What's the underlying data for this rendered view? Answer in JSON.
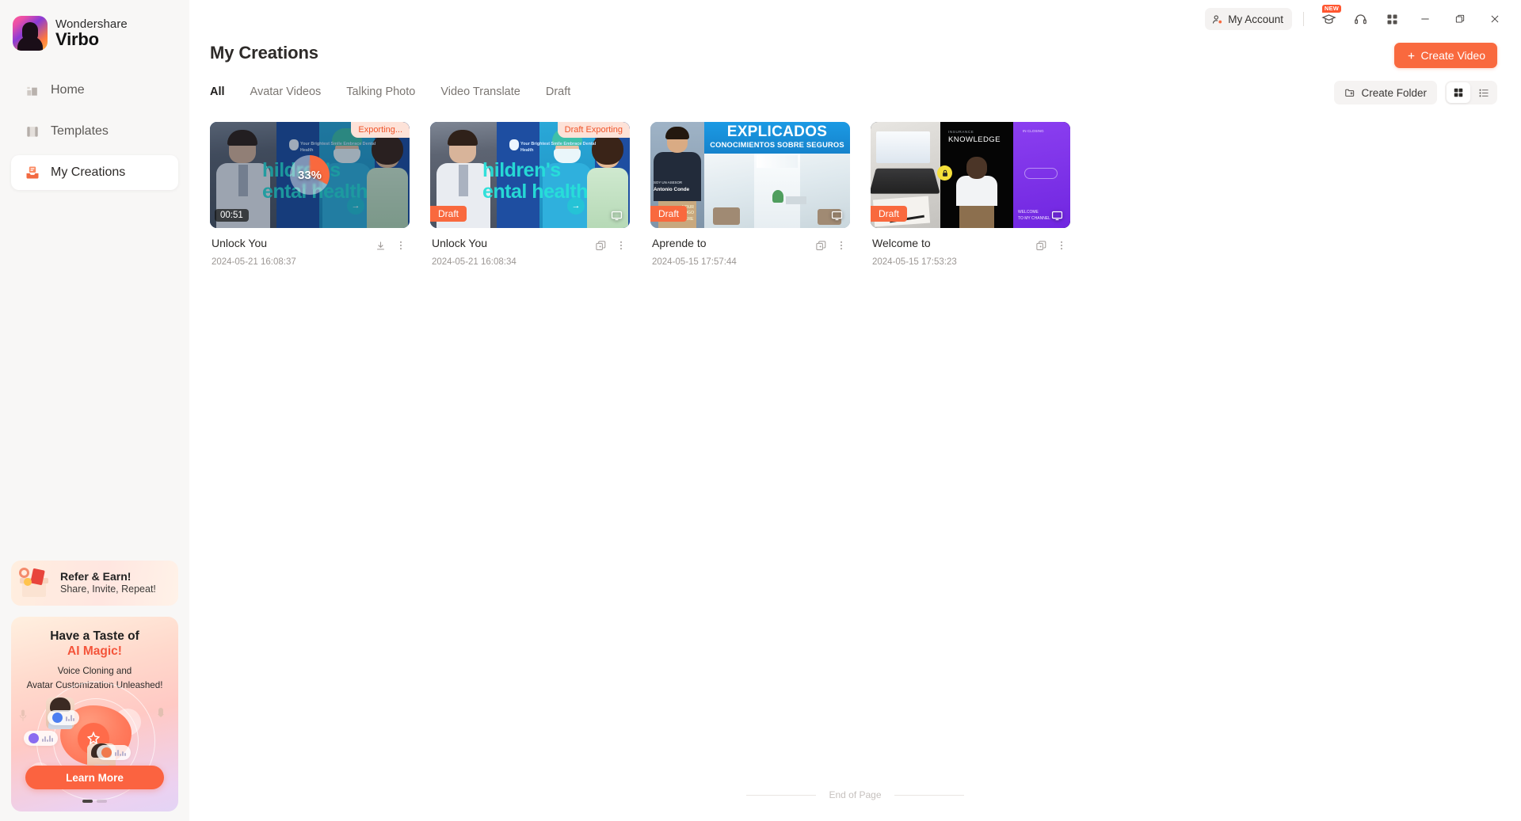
{
  "brand": {
    "top": "Wondershare",
    "bottom": "Virbo",
    "logo_icon": "virbo-avatar-logo"
  },
  "sidebar": {
    "items": [
      {
        "label": "Home",
        "icon": "home-icon",
        "active": false
      },
      {
        "label": "Templates",
        "icon": "templates-icon",
        "active": false
      },
      {
        "label": "My Creations",
        "icon": "my-creations-icon",
        "active": true
      }
    ],
    "refer": {
      "title": "Refer & Earn!",
      "subtitle": "Share, Invite, Repeat!",
      "icon": "gift-box-icon"
    },
    "magic": {
      "line1": "Have a Taste of",
      "line2": "AI Magic!",
      "line3": "Voice Cloning and",
      "line4": "Avatar Customization Unleashed!",
      "button": "Learn More",
      "accent": "#f4543a"
    }
  },
  "titlebar": {
    "account": "My Account",
    "icons": [
      "graduation-cap-icon",
      "headset-support-icon",
      "apps-grid-icon"
    ],
    "new_badge": "NEW",
    "window": [
      "minimize-icon",
      "maximize-icon",
      "close-icon"
    ]
  },
  "header": {
    "title": "My Creations",
    "create_video": "Create Video",
    "create_folder": "Create Folder"
  },
  "tabs": [
    {
      "label": "All",
      "active": true
    },
    {
      "label": "Avatar Videos",
      "active": false
    },
    {
      "label": "Talking Photo",
      "active": false
    },
    {
      "label": "Video Translate",
      "active": false
    },
    {
      "label": "Draft",
      "active": false
    }
  ],
  "view": {
    "grid": "grid-view-icon",
    "list": "list-view-icon",
    "selected": "grid"
  },
  "cards": [
    {
      "name": "Unlock You",
      "date": "2024-05-21 16:08:37",
      "badge": "Exporting...",
      "tag": null,
      "duration": "00:51",
      "progress": "33%",
      "progress_value": 33,
      "actions": [
        "download-icon",
        "more-menu-icon"
      ],
      "thumb_text": {
        "headline1": "hildren's",
        "headline2": "ental health",
        "caption": "Your Brightest Smile Embrace Dental Health"
      }
    },
    {
      "name": "Unlock You",
      "date": "2024-05-21 16:08:34",
      "badge": "Draft Exporting",
      "tag": "Draft",
      "duration": null,
      "progress": null,
      "actions": [
        "duplicate-icon",
        "more-menu-icon"
      ],
      "thumb_text": {
        "headline1": "hildren's",
        "headline2": "ental health",
        "caption": "Your Brightest Smile Embrace Dental Health"
      }
    },
    {
      "name": "Aprende to",
      "date": "2024-05-15 17:57:44",
      "badge": null,
      "tag": "Draft",
      "duration": null,
      "progress": null,
      "actions": [
        "duplicate-icon",
        "more-menu-icon"
      ],
      "thumb_text": {
        "headline1": "EXPLICADOS",
        "headline2": "CONOCIMIENTOS SOBRE SEGUROS",
        "caption": "Antonio Conde"
      }
    },
    {
      "name": "Welcome to",
      "date": "2024-05-15 17:53:23",
      "badge": null,
      "tag": "Draft",
      "duration": null,
      "progress": null,
      "actions": [
        "duplicate-icon",
        "more-menu-icon"
      ],
      "thumb_text": {
        "headline1": "INSURANCE",
        "headline2": "KNOWLEDGE",
        "caption": ""
      }
    }
  ],
  "footer": {
    "end_of_page": "End of Page"
  },
  "colors": {
    "accent": "#f9693e",
    "sidebar_bg": "#f8f7f6",
    "badge_bg": "#fde2d8",
    "badge_fg": "#f0542a"
  }
}
